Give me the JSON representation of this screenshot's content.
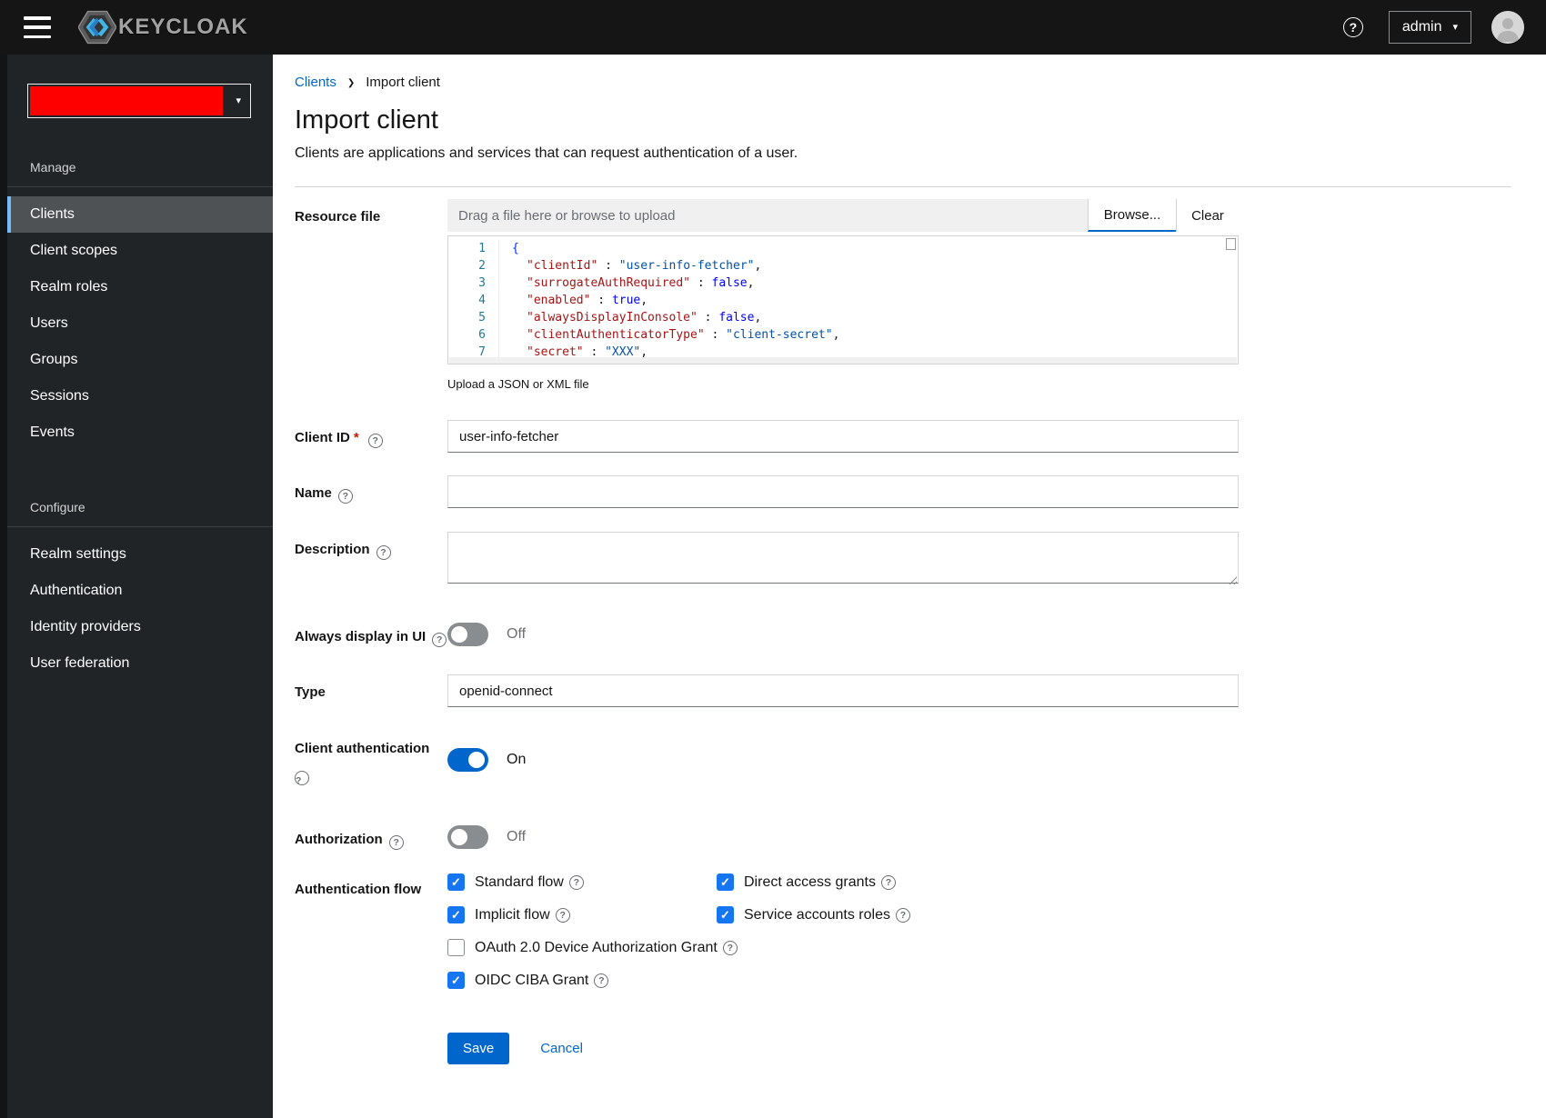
{
  "header": {
    "logo_text": "KEYCLOAK",
    "user_menu_label": "admin"
  },
  "sidebar": {
    "realm_selector": {
      "redacted": true,
      "redaction_color": "#fe0000"
    },
    "manage": {
      "heading": "Manage",
      "items": [
        {
          "label": "Clients",
          "selected": true
        },
        {
          "label": "Client scopes",
          "selected": false
        },
        {
          "label": "Realm roles",
          "selected": false
        },
        {
          "label": "Users",
          "selected": false
        },
        {
          "label": "Groups",
          "selected": false
        },
        {
          "label": "Sessions",
          "selected": false
        },
        {
          "label": "Events",
          "selected": false
        }
      ]
    },
    "configure": {
      "heading": "Configure",
      "items": [
        {
          "label": "Realm settings"
        },
        {
          "label": "Authentication"
        },
        {
          "label": "Identity providers"
        },
        {
          "label": "User federation"
        }
      ]
    }
  },
  "breadcrumb": {
    "link": "Clients",
    "current": "Import client"
  },
  "page": {
    "title": "Import client",
    "subtitle": "Clients are applications and services that can request authentication of a user."
  },
  "form": {
    "resource_file": {
      "label": "Resource file",
      "placeholder": "Drag a file here or browse to upload",
      "browse": "Browse...",
      "clear": "Clear",
      "helper": "Upload a JSON or XML file"
    },
    "editor": {
      "lines": [
        {
          "num": "1",
          "open": "{"
        },
        {
          "num": "2",
          "key": "\"clientId\"",
          "sep": " : ",
          "val": "\"user-info-fetcher\"",
          "end": ","
        },
        {
          "num": "3",
          "key": "\"surrogateAuthRequired\"",
          "sep": " : ",
          "bool": "false",
          "end": ","
        },
        {
          "num": "4",
          "key": "\"enabled\"",
          "sep": " : ",
          "bool": "true",
          "end": ","
        },
        {
          "num": "5",
          "key": "\"alwaysDisplayInConsole\"",
          "sep": " : ",
          "bool": "false",
          "end": ","
        },
        {
          "num": "6",
          "key": "\"clientAuthenticatorType\"",
          "sep": " : ",
          "val": "\"client-secret\"",
          "end": ","
        },
        {
          "num": "7",
          "key": "\"secret\"",
          "sep": " : ",
          "val": "\"XXX\"",
          "end": ","
        }
      ]
    },
    "client_id": {
      "label": "Client ID",
      "required": "*",
      "value": "user-info-fetcher"
    },
    "name": {
      "label": "Name",
      "value": ""
    },
    "description": {
      "label": "Description",
      "value": ""
    },
    "always_display": {
      "label": "Always display in UI",
      "state": "Off",
      "on": false
    },
    "type": {
      "label": "Type",
      "value": "openid-connect"
    },
    "client_auth": {
      "label": "Client authentication",
      "state": "On",
      "on": true
    },
    "authorization": {
      "label": "Authorization",
      "state": "Off",
      "on": false
    },
    "auth_flow": {
      "label": "Authentication flow",
      "checkboxes": [
        {
          "label": "Standard flow",
          "checked": true
        },
        {
          "label": "Direct access grants",
          "checked": true
        },
        {
          "label": "Implicit flow",
          "checked": true
        },
        {
          "label": "Service accounts roles",
          "checked": true
        },
        {
          "label": "OAuth 2.0 Device Authorization Grant",
          "checked": false
        },
        {
          "label": "OIDC CIBA Grant",
          "checked": true
        }
      ]
    },
    "actions": {
      "save": "Save",
      "cancel": "Cancel"
    }
  },
  "icons": {
    "help": "?",
    "caret_down": "▾",
    "breadcrumb_chevron": "❯",
    "check": "✓"
  },
  "colors": {
    "masthead_bg": "#151515",
    "sidebar_bg": "#212427",
    "sidebar_selected_bg": "#4f5255",
    "nav_active_bar": "#73bcf7",
    "primary_blue": "#0066cc",
    "checkbox_blue": "#1675f0",
    "redaction_red": "#fe0000",
    "code_key": "#a31515",
    "code_string": "#0451a5",
    "code_bool": "#0000ff",
    "code_linenum": "#237893"
  }
}
